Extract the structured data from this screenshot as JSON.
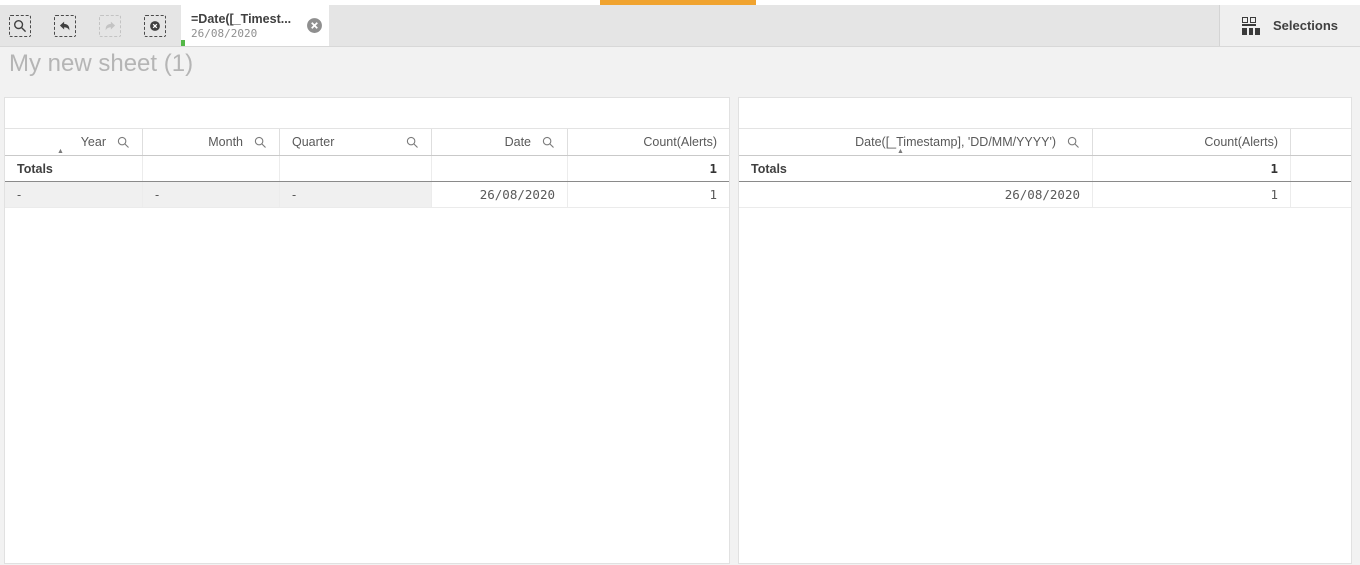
{
  "toolbar": {
    "chip": {
      "title": "=Date([_Timest...",
      "value": "26/08/2020"
    },
    "selections_label": "Selections"
  },
  "sheet_title": "My new sheet (1)",
  "tables": {
    "left": {
      "columns": [
        "Year",
        "Month",
        "Quarter",
        "Date",
        "Count(Alerts)"
      ],
      "totals_label": "Totals",
      "totals_count": "1",
      "row": {
        "year": "-",
        "month": "-",
        "quarter": "-",
        "date": "26/08/2020",
        "count": "1"
      }
    },
    "right": {
      "columns": [
        "Date([_Timestamp], 'DD/MM/YYYY')",
        "Count(Alerts)"
      ],
      "totals_label": "Totals",
      "totals_count": "1",
      "row": {
        "date": "26/08/2020",
        "count": "1"
      }
    }
  },
  "colors": {
    "accent_orange": "#f0a32f",
    "selection_green": "#54b848"
  }
}
